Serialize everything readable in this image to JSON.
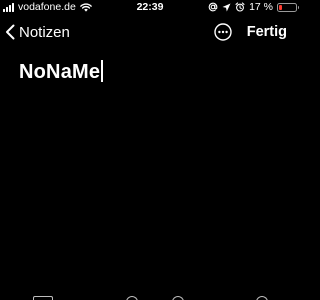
{
  "status_bar": {
    "carrier": "vodafone.de",
    "time": "22:39",
    "battery_percent_label": "17 %",
    "battery_level": 0.17,
    "battery_color": "#ff3b30",
    "icons": [
      "signal-bars-icon",
      "wifi-icon",
      "at-icon",
      "location-arrow-icon",
      "alarm-icon",
      "battery-icon"
    ]
  },
  "nav": {
    "back_label": "Notizen",
    "more_icon": "ellipsis-circle-icon",
    "done_label": "Fertig"
  },
  "note": {
    "title": "NoNaMe"
  },
  "toolbar": {
    "icons": [
      "table-icon",
      "formatting-icon",
      "checklist-icon",
      "camera-icon",
      "markup-icon"
    ]
  }
}
